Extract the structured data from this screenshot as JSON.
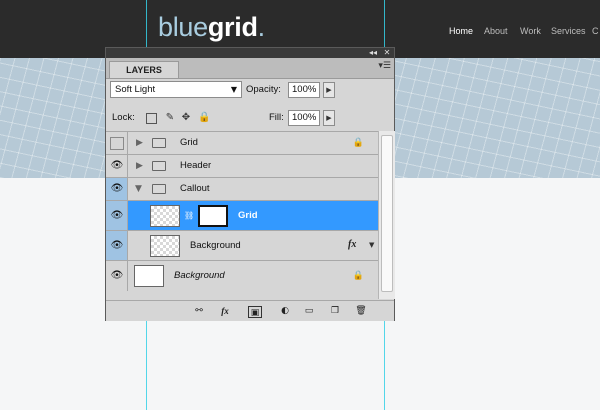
{
  "site": {
    "logo_light": "blue",
    "logo_bold": "grid",
    "logo_dot": ".",
    "nav": [
      "Home",
      "About",
      "Work",
      "Services",
      "C"
    ]
  },
  "panel": {
    "tab": "LAYERS",
    "blend_mode": "Soft Light",
    "opacity_label": "Opacity:",
    "opacity_value": "100%",
    "lock_label": "Lock:",
    "fill_label": "Fill:",
    "fill_value": "100%",
    "layers": [
      {
        "name": "Grid",
        "type": "group",
        "visible": false,
        "locked": true
      },
      {
        "name": "Header",
        "type": "group",
        "visible": true
      },
      {
        "name": "Callout",
        "type": "group",
        "visible": true,
        "expanded": true
      },
      {
        "name": "Grid",
        "type": "layer",
        "visible": true,
        "selected": true,
        "has_mask": true
      },
      {
        "name": "Background",
        "type": "layer",
        "visible": true,
        "fx": "fx"
      },
      {
        "name": "Background",
        "type": "layer",
        "visible": true,
        "locked": true,
        "italic": true
      }
    ],
    "fx_label": "fx",
    "colors": {
      "selected": "#3399ff",
      "eye_bg": "#9fc3e3",
      "guide": "#35d0e6"
    }
  }
}
